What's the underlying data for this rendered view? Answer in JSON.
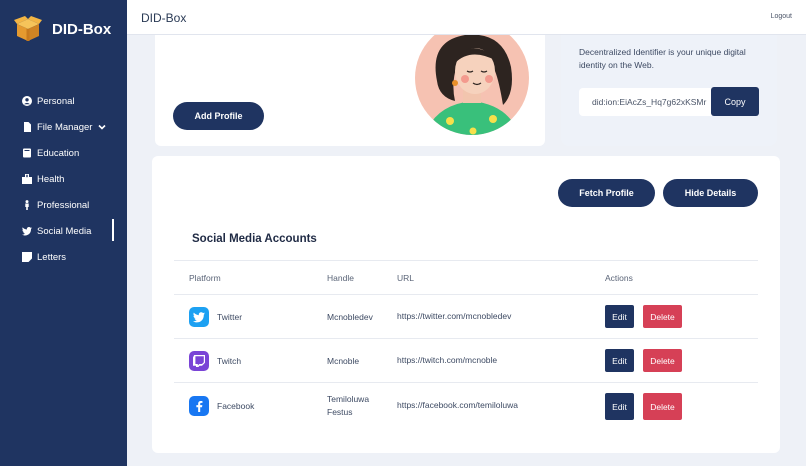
{
  "brand": {
    "name": "DID-Box",
    "icon": "box-icon"
  },
  "sidebar": {
    "items": [
      {
        "label": "Personal",
        "icon": "user-circle-icon"
      },
      {
        "label": "File Manager",
        "icon": "file-icon"
      },
      {
        "label": "Education",
        "icon": "book-icon"
      },
      {
        "label": "Health",
        "icon": "hospital-icon"
      },
      {
        "label": "Professional",
        "icon": "person-icon"
      },
      {
        "label": "Social Media",
        "icon": "twitter-icon"
      },
      {
        "label": "Letters",
        "icon": "sticky-note-icon"
      }
    ]
  },
  "header": {
    "title": "DID-Box",
    "logout": "Logout"
  },
  "profile": {
    "add_label": "Add Profile"
  },
  "did": {
    "description": "Decentralized Identifier is your unique digital identity on the Web.",
    "value": "did:ion:EiAcZs_Hq7g62xKSMr",
    "copy_label": "Copy"
  },
  "actions": {
    "fetch_label": "Fetch Profile",
    "hide_label": "Hide Details"
  },
  "social": {
    "title": "Social Media Accounts",
    "columns": [
      "Platform",
      "Handle",
      "URL",
      "Actions"
    ],
    "rows": [
      {
        "platform": "Twitter",
        "handle": "Mcnobledev",
        "url": "https://twitter.com/mcnobledev",
        "edit": "Edit",
        "delete": "Delete",
        "icon": "twitter-icon",
        "color": "#1da1f2"
      },
      {
        "platform": "Twitch",
        "handle": "Mcnoble",
        "url": "https://twitch.com/mcnoble",
        "edit": "Edit",
        "delete": "Delete",
        "icon": "twitch-icon",
        "color": "#7a44d6"
      },
      {
        "platform": "Facebook",
        "handle": "Temiloluwa Festus",
        "url": "https://facebook.com/temiloluwa",
        "edit": "Edit",
        "delete": "Delete",
        "icon": "facebook-icon",
        "color": "#1877f2"
      }
    ]
  },
  "colors": {
    "sidebar": "#1f3461",
    "primary_button": "#1f3461",
    "danger": "#d64056"
  }
}
